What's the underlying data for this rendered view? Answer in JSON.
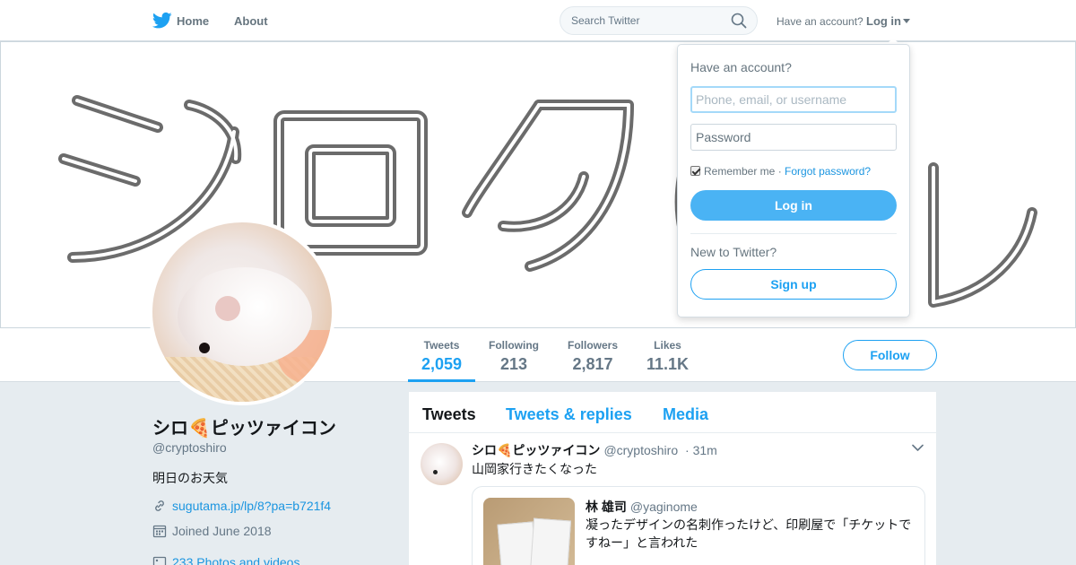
{
  "nav": {
    "home_label": "Home",
    "about_label": "About",
    "search_placeholder": "Search Twitter",
    "have_account": "Have an account?",
    "login_label": "Log in"
  },
  "banner": {
    "text": "シロクル"
  },
  "stats": [
    {
      "label": "Tweets",
      "value": "2,059",
      "active": true
    },
    {
      "label": "Following",
      "value": "213",
      "active": false
    },
    {
      "label": "Followers",
      "value": "2,817",
      "active": false
    },
    {
      "label": "Likes",
      "value": "11.1K",
      "active": false
    }
  ],
  "follow_label": "Follow",
  "profile": {
    "name": "シロ🍕ピッツァイコン",
    "handle": "@cryptoshiro",
    "bio": "明日のお天気",
    "url": "sugutama.jp/lp/8?pa=b721f4",
    "joined": "Joined June 2018",
    "photos": "233 Photos and videos"
  },
  "timeline": {
    "tabs": [
      "Tweets",
      "Tweets & replies",
      "Media"
    ],
    "tweet": {
      "name": "シロ🍕ピッツァイコン",
      "handle": "@cryptoshiro",
      "time": "· 31m",
      "text": "山岡家行きたくなった",
      "quote": {
        "name": "林 雄司",
        "handle": "@yaginome",
        "text": "凝ったデザインの名刺作ったけど、印刷屋で「チケットですねー」と言われた"
      }
    }
  },
  "login_dropdown": {
    "question": "Have an account?",
    "username_placeholder": "Phone, email, or username",
    "password_placeholder": "Password",
    "remember": "Remember me",
    "separator": "·",
    "forgot": "Forgot password?",
    "login_button": "Log in",
    "new_question": "New to Twitter?",
    "signup_button": "Sign up"
  },
  "colors": {
    "accent": "#1da1f2",
    "login_button_bg": "#4ab3f4",
    "page_bg": "#e6ecf0",
    "muted_text": "#657786"
  }
}
